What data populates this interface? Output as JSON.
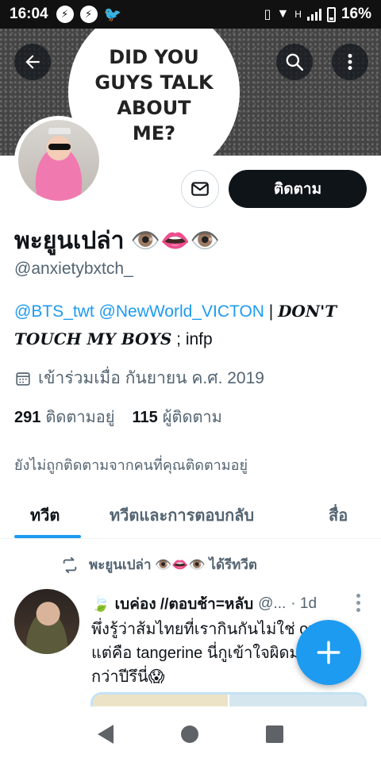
{
  "status_bar": {
    "time": "16:04",
    "battery_percent": "16%",
    "network_label": "H"
  },
  "banner": {
    "text_lines": [
      "DID YOU",
      "GUYS TALK",
      "ABOUT",
      "ME?"
    ]
  },
  "profile": {
    "follow_button_label": "ติดตาม",
    "display_name": "พะยูนเปล่า 👁️👄👁️",
    "handle": "@anxietybxtch_",
    "bio": {
      "mention_1": "@BTS_twt",
      "mention_2": "@NewWorld_VICTON",
      "separator": " | ",
      "bold_line_1": "DON'T",
      "bold_line_2": "TOUCH MY BOYS",
      "suffix": " ; infp"
    },
    "joined": "เข้าร่วมเมื่อ กันยายน ค.ศ. 2019",
    "following_count": "291",
    "following_label": "ติดตามอยู่",
    "followers_count": "115",
    "followers_label": "ผู้ติดตาม",
    "not_followed_text": "ยังไม่ถูกติดตามจากคนที่คุณติดตามอยู่"
  },
  "tabs": [
    {
      "label": "ทวีต",
      "active": true
    },
    {
      "label": "ทวีตและการตอบกลับ",
      "active": false
    },
    {
      "label": "สื่อ",
      "active": false
    }
  ],
  "tweet": {
    "retweet_text": "พะยูนเปล่า 👁️👄👁️ ได้รีทวีต",
    "author_prefix": "🍃",
    "author_name": "เบค่อง //ตอบช้า=หลับ",
    "author_handle": "@...",
    "time": "· 1d",
    "body_line_1": "พึ่งรู้ว่าส้มไทยที่เรากินกันไม่ใช่ orange",
    "body_line_2": "แต่คือ tangerine นี่กูเข้าใจผิดมา 20",
    "body_line_3": "กว่าปีรึนี่😱"
  },
  "colors": {
    "accent": "#1d9bf0",
    "text_primary": "#0f1419",
    "text_secondary": "#536471",
    "follow_button_bg": "#0f1419"
  },
  "icons": {
    "back": "arrow-left-icon",
    "search": "search-icon",
    "more": "more-vertical-icon",
    "message": "envelope-icon",
    "calendar": "calendar-icon",
    "retweet": "retweet-icon",
    "compose": "plus-icon"
  }
}
